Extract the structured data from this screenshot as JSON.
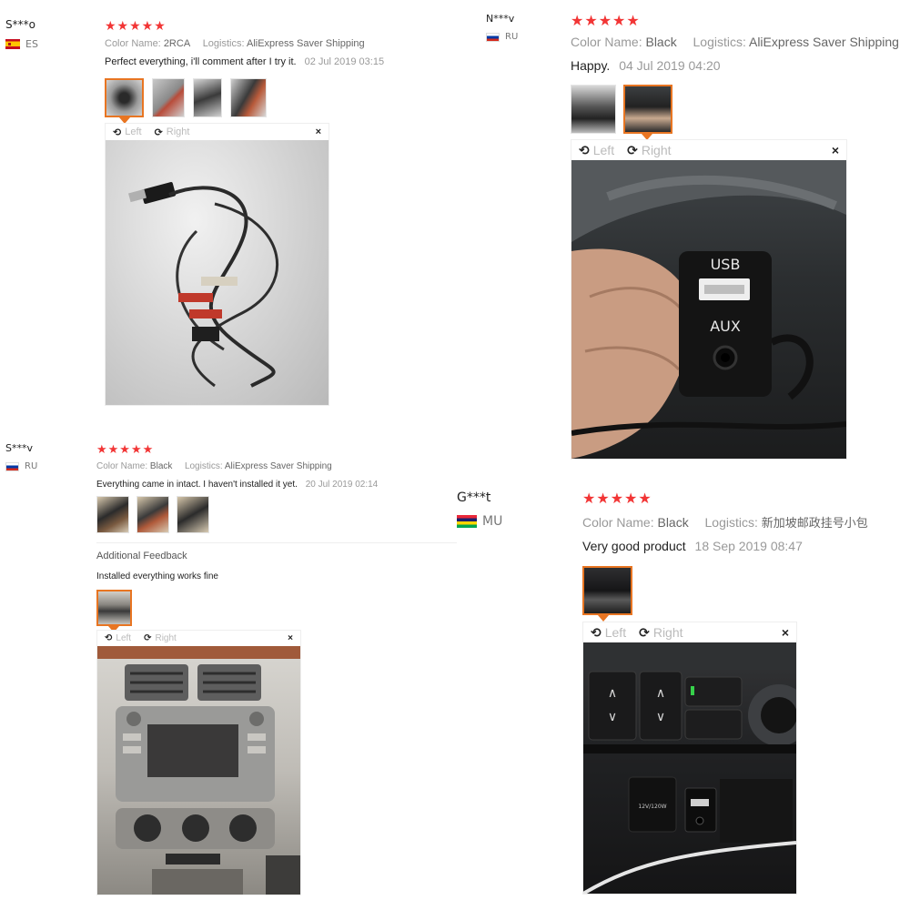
{
  "reviews": [
    {
      "user": "S***o",
      "country": "ES",
      "stars": "★★★★★",
      "color_label": "Color Name:",
      "color_value": "2RCA",
      "logistics_label": "Logistics:",
      "logistics_value": "AliExpress Saver Shipping",
      "comment": "Perfect everything, i'll comment after I try it.",
      "date": "02 Jul 2019 03:15",
      "viewer": {
        "left": "Left",
        "right": "Right",
        "close": "×"
      }
    },
    {
      "user": "N***v",
      "country": "RU",
      "stars": "★★★★★",
      "color_label": "Color Name:",
      "color_value": "Black",
      "logistics_label": "Logistics:",
      "logistics_value": "AliExpress Saver Shipping",
      "comment": "Happy.",
      "date": "04 Jul 2019 04:20",
      "viewer": {
        "left": "Left",
        "right": "Right",
        "close": "×"
      },
      "photo_labels": {
        "usb": "USB",
        "aux": "AUX"
      }
    },
    {
      "user": "S***v",
      "country": "RU",
      "stars": "★★★★★",
      "color_label": "Color Name:",
      "color_value": "Black",
      "logistics_label": "Logistics:",
      "logistics_value": "AliExpress Saver Shipping",
      "comment": "Everything came in intact. I haven't installed it yet.",
      "date": "20 Jul 2019 02:14",
      "additional_title": "Additional Feedback",
      "additional_text": "Installed everything works fine",
      "viewer": {
        "left": "Left",
        "right": "Right",
        "close": "×"
      }
    },
    {
      "user": "G***t",
      "country": "MU",
      "stars": "★★★★★",
      "color_label": "Color Name:",
      "color_value": "Black",
      "logistics_label": "Logistics:",
      "logistics_value": "新加坡邮政挂号小包",
      "comment": "Very good product",
      "date": "18 Sep 2019 08:47",
      "viewer": {
        "left": "Left",
        "right": "Right",
        "close": "×"
      },
      "photo_labels": {
        "voltage": "12V/120W"
      }
    }
  ],
  "colors": {
    "star": "#f23535",
    "active_border": "#e87522",
    "muted": "#999999"
  },
  "icons": [
    "rotate-left-icon",
    "rotate-right-icon",
    "close-icon",
    "flag-es-icon",
    "flag-ru-icon",
    "flag-mu-icon"
  ]
}
